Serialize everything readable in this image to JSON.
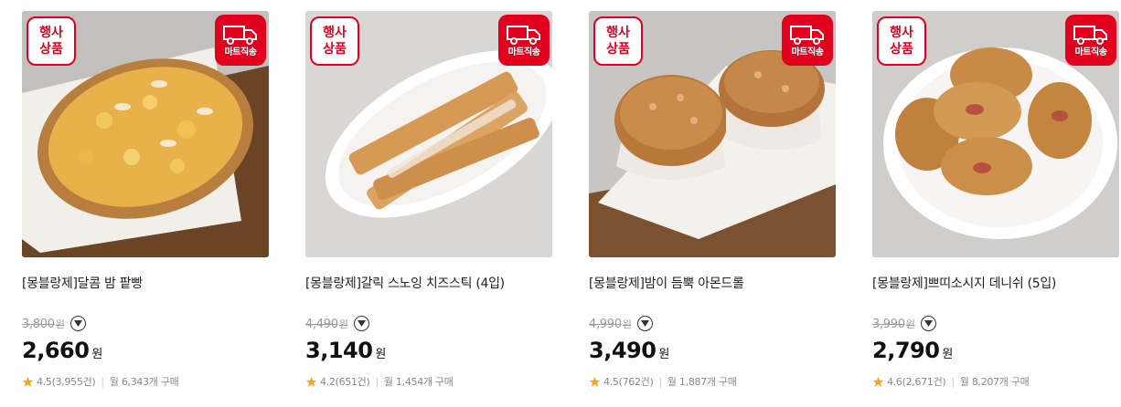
{
  "colors": {
    "accent": "#e1001e",
    "star": "#f5a623"
  },
  "products": [
    {
      "event_badge": [
        "행사",
        "상품"
      ],
      "delivery_badge": "마트직송",
      "title": "[몽블랑제]달콤 밤 팥빵",
      "original_price": "3,800",
      "original_unit": "원",
      "sale_price": "2,660",
      "sale_unit": "원",
      "rating": "4.5(3,955건)",
      "monthly": "월 6,343개 구매",
      "image_icon": "flatbread-on-board-photo"
    },
    {
      "event_badge": [
        "행사",
        "상품"
      ],
      "delivery_badge": "마트직송",
      "title": "[몽블랑제]갈릭 스노잉 치즈스틱 (4입)",
      "original_price": "4,490",
      "original_unit": "원",
      "sale_price": "3,140",
      "sale_unit": "원",
      "rating": "4.2(651건)",
      "monthly": "월 1,454개 구매",
      "image_icon": "cheese-sticks-on-plate-photo"
    },
    {
      "event_badge": [
        "행사",
        "상품"
      ],
      "delivery_badge": "마트직송",
      "title": "[몽블랑제]밤이 듬뿍 아몬드롤",
      "original_price": "4,990",
      "original_unit": "원",
      "sale_price": "3,490",
      "sale_unit": "원",
      "rating": "4.5(762건)",
      "monthly": "월 1,887개 구매",
      "image_icon": "muffins-on-board-photo"
    },
    {
      "event_badge": [
        "행사",
        "상품"
      ],
      "delivery_badge": "마트직송",
      "title": "[몽블랑제]쁘띠소시지 데니쉬 (5입)",
      "original_price": "3,990",
      "original_unit": "원",
      "sale_price": "2,790",
      "sale_unit": "원",
      "rating": "4.6(2,671건)",
      "monthly": "월 8,207개 구매",
      "image_icon": "sausage-danish-on-plate-photo"
    }
  ]
}
